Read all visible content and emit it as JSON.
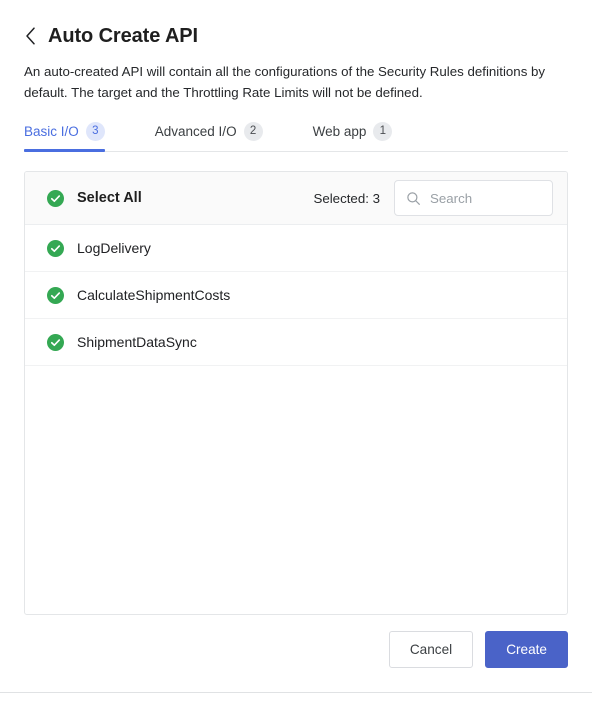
{
  "header": {
    "back_icon": "chevron-left-icon",
    "title": "Auto Create API",
    "description": "An auto-created API will contain all the configurations of the Security Rules definitions by default. The target and the Throttling Rate Limits will not be defined."
  },
  "tabs": [
    {
      "label": "Basic I/O",
      "badge": "3",
      "active": true
    },
    {
      "label": "Advanced I/O",
      "badge": "2",
      "active": false
    },
    {
      "label": "Web app",
      "badge": "1",
      "active": false
    }
  ],
  "card": {
    "select_all_label": "Select All",
    "select_all_checked": true,
    "selected_text": "Selected: 3",
    "search": {
      "icon": "search-icon",
      "placeholder": "Search",
      "value": ""
    },
    "items": [
      {
        "label": "LogDelivery",
        "checked": true,
        "check_icon": "check-circle-icon"
      },
      {
        "label": "CalculateShipmentCosts",
        "checked": true,
        "check_icon": "check-circle-icon"
      },
      {
        "label": "ShipmentDataSync",
        "checked": true,
        "check_icon": "check-circle-icon"
      }
    ]
  },
  "footer": {
    "cancel_label": "Cancel",
    "create_label": "Create"
  },
  "colors": {
    "accent_blue": "#4a6ee0",
    "primary_button": "#4a63c8",
    "check_green": "#34a853",
    "border": "#e4e6e8",
    "header_bg": "#fafafa",
    "muted_text": "#9aa0a6"
  }
}
